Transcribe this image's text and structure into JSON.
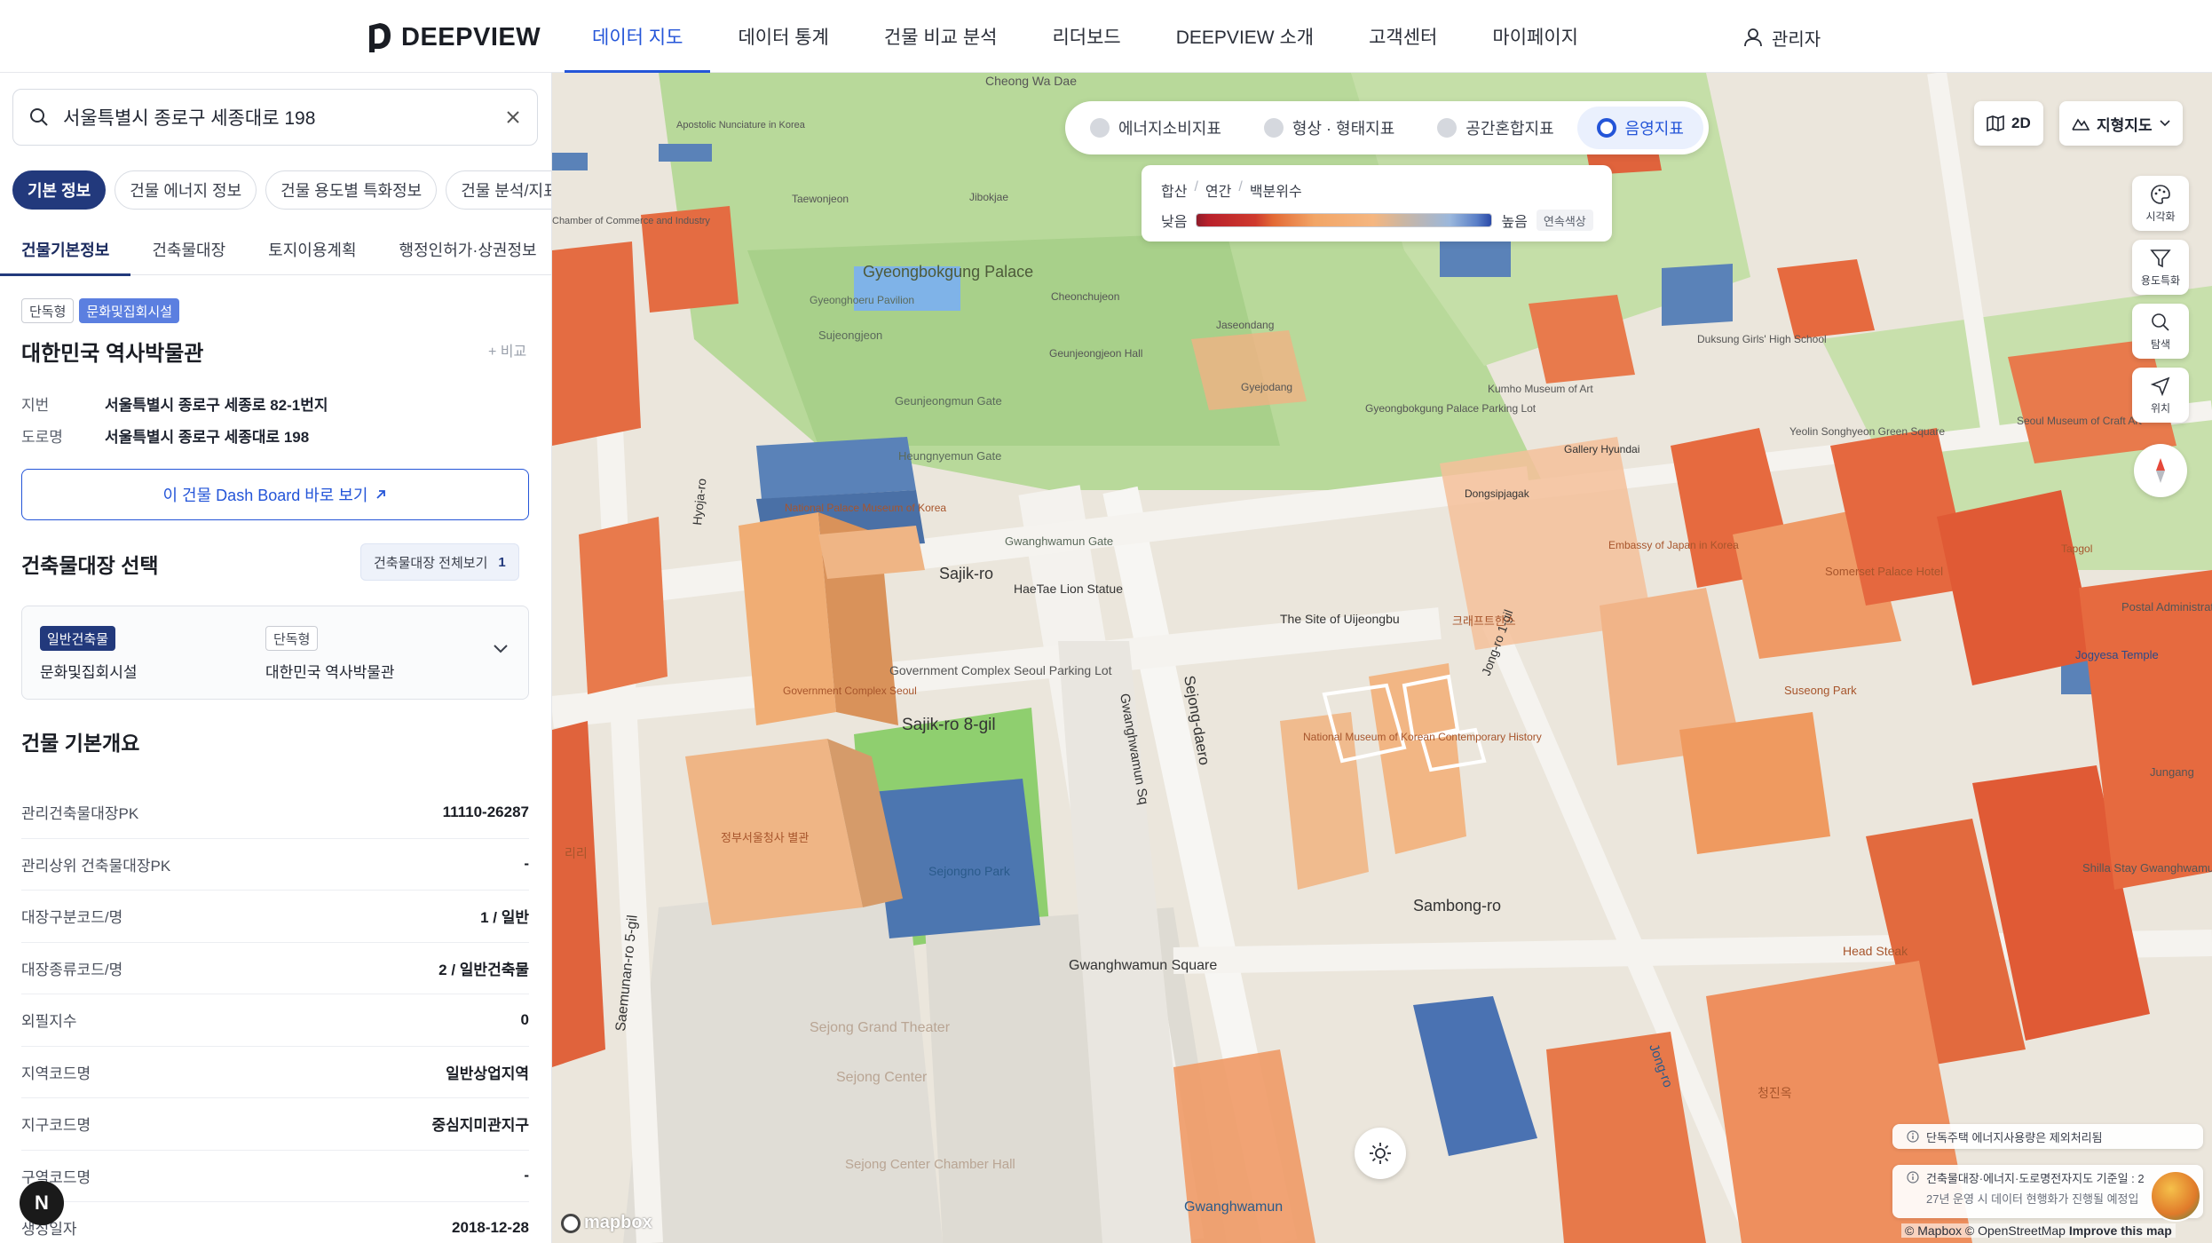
{
  "brand": {
    "name": "DEEPVIEW"
  },
  "nav": {
    "items": [
      {
        "label": "데이터 지도",
        "active": true
      },
      {
        "label": "데이터 통계",
        "active": false
      },
      {
        "label": "건물 비교 분석",
        "active": false
      },
      {
        "label": "리더보드",
        "active": false
      },
      {
        "label": "DEEPVIEW 소개",
        "active": false
      },
      {
        "label": "고객센터",
        "active": false
      },
      {
        "label": "마이페이지",
        "active": false
      }
    ],
    "user_label": "관리자"
  },
  "search": {
    "value": "서울특별시 종로구 세종대로 198"
  },
  "chips": [
    {
      "label": "기본 정보",
      "active": true
    },
    {
      "label": "건물 에너지 정보",
      "active": false
    },
    {
      "label": "건물 용도별 특화정보",
      "active": false
    },
    {
      "label": "건물 분석/지표 정보",
      "active": false
    }
  ],
  "subtabs": [
    {
      "label": "건물기본정보",
      "active": true
    },
    {
      "label": "건축물대장",
      "active": false
    },
    {
      "label": "토지이용계획",
      "active": false
    },
    {
      "label": "행정인허가·상권정보",
      "active": false
    }
  ],
  "building": {
    "badges": [
      "단독형",
      "문화및집회시설"
    ],
    "name": "대한민국 역사박물관",
    "compare_label": "+ 비교",
    "lot_label": "지번",
    "lot_value": "서울특별시 종로구 세종로 82-1번지",
    "road_label": "도로명",
    "road_value": "서울특별시 종로구 세종대로 198",
    "dashboard_label": "이 건물 Dash Board 바로 보기"
  },
  "ledger": {
    "section_title": "건축물대장 선택",
    "view_all_label": "건축물대장 전체보기",
    "count": "1",
    "card": {
      "type_badge": "일반건축물",
      "use": "문화및집회시설",
      "form_badge": "단독형",
      "name": "대한민국 역사박물관"
    }
  },
  "overview": {
    "section_title": "건물 기본개요",
    "rows": [
      {
        "key": "관리건축물대장PK",
        "value": "11110-26287"
      },
      {
        "key": "관리상위 건축물대장PK",
        "value": "-"
      },
      {
        "key": "대장구분코드/명",
        "value": "1 / 일반"
      },
      {
        "key": "대장종류코드/명",
        "value": "2 / 일반건축물"
      },
      {
        "key": "외필지수",
        "value": "0"
      },
      {
        "key": "지역코드명",
        "value": "일반상업지역"
      },
      {
        "key": "지구코드명",
        "value": "중심지미관지구"
      },
      {
        "key": "구역코드명",
        "value": "-"
      },
      {
        "key": "생성일자",
        "value": "2018-12-28"
      }
    ]
  },
  "floating_button": {
    "label": "N"
  },
  "map": {
    "layer_tabs": [
      {
        "label": "에너지소비지표",
        "active": false
      },
      {
        "label": "형상 · 형태지표",
        "active": false
      },
      {
        "label": "공간혼합지표",
        "active": false
      },
      {
        "label": "음영지표",
        "active": true
      }
    ],
    "legend": {
      "crumbs": [
        "합산",
        "연간",
        "백분위수"
      ],
      "low": "낮음",
      "high": "높음",
      "mode": "연속색상"
    },
    "view_mode": "2D",
    "basemap": "지형지도",
    "tools": [
      {
        "icon": "palette-icon",
        "label": "시각화"
      },
      {
        "icon": "filter-icon",
        "label": "용도특화"
      },
      {
        "icon": "search-icon",
        "label": "탐색"
      },
      {
        "icon": "location-icon",
        "label": "위치"
      }
    ],
    "labels": [
      "Gyeongbokgung Palace",
      "Gyeonghoeru Pavilion",
      "Sujeongjeon",
      "Geunjeongmun Gate",
      "Heungnyemun Gate",
      "Gwanghwamun Gate",
      "Sajik-ro",
      "HaeTae Lion Statue",
      "The Site of Uijeongbu",
      "Government Complex Seoul Parking Lot",
      "Sajik-ro 8-gil",
      "Sejongno Park",
      "Sejong-daero",
      "Gwanghwamun Sq",
      "Sambong-ro",
      "Gwanghwamun Square",
      "Sejong Grand Theater",
      "Sejong Center",
      "Sejong Center Chamber Hall",
      "Saemunan-ro 5-gil",
      "National Palace Museum of Korea",
      "Hyoja-ro",
      "Jong-ro 1-gil",
      "Suseong Park",
      "Somerset Palace Hotel",
      "Postal Administration",
      "Jogyesa Temple",
      "Shilla Stay Gwanghwamun",
      "Head Steak",
      "Jong-ro",
      "Gwanghwamun",
      "Jungang",
      "Tapgol",
      "Dongsipjagak",
      "Gyeongbokgung Palace Parking Lot",
      "National Museum of Korean Contemporary History",
      "Cheong Wa Dae",
      "Taewonjeon",
      "Jibokjae",
      "Jaseondang",
      "Gyejodang",
      "Geunjeongjeon Hall",
      "Embassy of Japan in Korea",
      "Gallery Hyundai",
      "Kumho Museum of Art",
      "Seoul Museum of Craft Art",
      "Yeolin Songhyeon Green Square",
      "Duksung Girls' High School",
      "Cheonchujeon",
      "Apostolic Nunciature in Korea",
      "Chamber of Commerce and Industry",
      "Government Complex Seoul",
      "정부서울청사 별관",
      "리리",
      "청진옥",
      "크래프트한스"
    ],
    "notices": [
      {
        "text": "단독주택 에너지사용량은 제외처리됨"
      },
      {
        "text": "건축물대장·에너지·도로명전자지도 기준일 : 2",
        "sub": "27년 운영 시 데이터 현행화가 진행될 예정입"
      }
    ],
    "attribution": {
      "prefix": "© Mapbox © OpenStreetMap",
      "link": "Improve this map"
    },
    "provider_logo": "mapbox"
  }
}
